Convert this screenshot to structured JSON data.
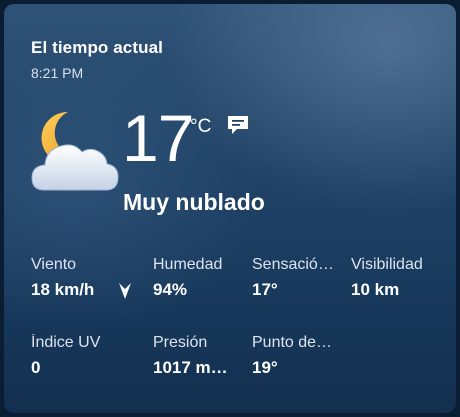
{
  "widget": {
    "title": "El tiempo actual",
    "time": "8:21 PM",
    "icon": "partly-cloudy-night-icon",
    "temperature": "17",
    "unit": "°C",
    "condition": "Muy nublado"
  },
  "stats": [
    {
      "label": "Viento",
      "value": "18 km/h"
    },
    {
      "label": "Humedad",
      "value": "94%"
    },
    {
      "label": "Sensació…",
      "value": "17°"
    },
    {
      "label": "Visibilidad",
      "value": "10 km"
    },
    {
      "label": "Índice UV",
      "value": "0"
    },
    {
      "label": "Presión",
      "value": "1017 m…"
    },
    {
      "label": "Punto de…",
      "value": "19°"
    }
  ],
  "colors": {
    "background_top": "#2f5377",
    "background_bottom": "#132f4f",
    "moon": "#f4b23a"
  }
}
